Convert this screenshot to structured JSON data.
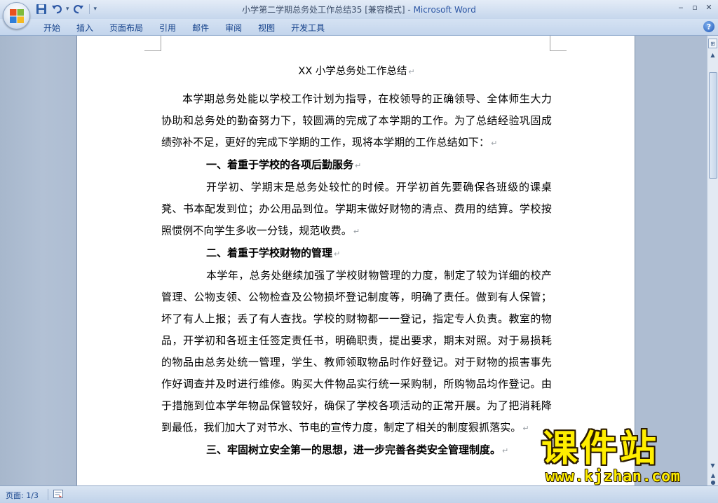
{
  "window": {
    "title": "小学第二学期总务处工作总结35 [兼容模式]",
    "title_separator": " - ",
    "app_name": "Microsoft Word",
    "controls": {
      "minimize": "‒",
      "restore": "▫",
      "close": "✕"
    }
  },
  "quick_access": {
    "icons": [
      "save-icon",
      "undo-icon",
      "redo-icon",
      "customize-icon"
    ],
    "undo_dropdown": "▾",
    "customize": "▾"
  },
  "ribbon": {
    "tabs": [
      "开始",
      "插入",
      "页面布局",
      "引用",
      "邮件",
      "审阅",
      "视图",
      "开发工具"
    ],
    "help_label": "?"
  },
  "document": {
    "title": "XX 小学总务处工作总结",
    "paragraph_mark": "↵",
    "intro": "本学期总务处能以学校工作计划为指导，在校领导的正确领导、全体师生大力协助和总务处的勤奋努力下，较圆满的完成了本学期的工作。为了总结经验巩固成绩弥补不足，更好的完成下学期的工作，现将本学期的工作总结如下：",
    "sections": [
      {
        "heading": "一、着重于学校的各项后勤服务",
        "body": "开学初、学期末是总务处较忙的时候。开学初首先要确保各班级的课桌凳、书本配发到位；办公用品到位。学期末做好财物的清点、费用的结算。学校按照惯例不向学生多收一分钱，规范收费。"
      },
      {
        "heading": "二、着重于学校财物的管理",
        "body": "本学年，总务处继续加强了学校财物管理的力度，制定了较为详细的校产管理、公物支领、公物检查及公物损坏登记制度等，明确了责任。做到有人保管；坏了有人上报；丢了有人查找。学校的财物都一一登记，指定专人负责。教室的物品，开学初和各班主任签定责任书，明确职责，提出要求，期末对照。对于易损耗的物品由总务处统一管理，学生、教师领取物品时作好登记。对于财物的损害事先作好调查并及时进行维修。购买大件物品实行统一采购制，所购物品均作登记。由于措施到位本学年物品保管较好，确保了学校各项活动的正常开展。为了把消耗降到最低，我们加大了对节水、节电的宣传力度，制定了相关的制度狠抓落实。"
      },
      {
        "heading": "三、牢固树立安全第一的思想，进一步完善各类安全管理制度。",
        "body": ""
      }
    ]
  },
  "scrollbar": {
    "up": "▲",
    "down": "▼",
    "ruler_toggle": "⊞",
    "prev_page": "▲",
    "select_browse": "●",
    "next_page": "▼"
  },
  "status": {
    "page": "页面: 1/3"
  },
  "watermark": {
    "text": "课件站",
    "url": "www.kjzhan.com"
  },
  "colors": {
    "ribbon_text": "#15428b",
    "app_name": "#2c56a4",
    "watermark": "#ffee00"
  }
}
